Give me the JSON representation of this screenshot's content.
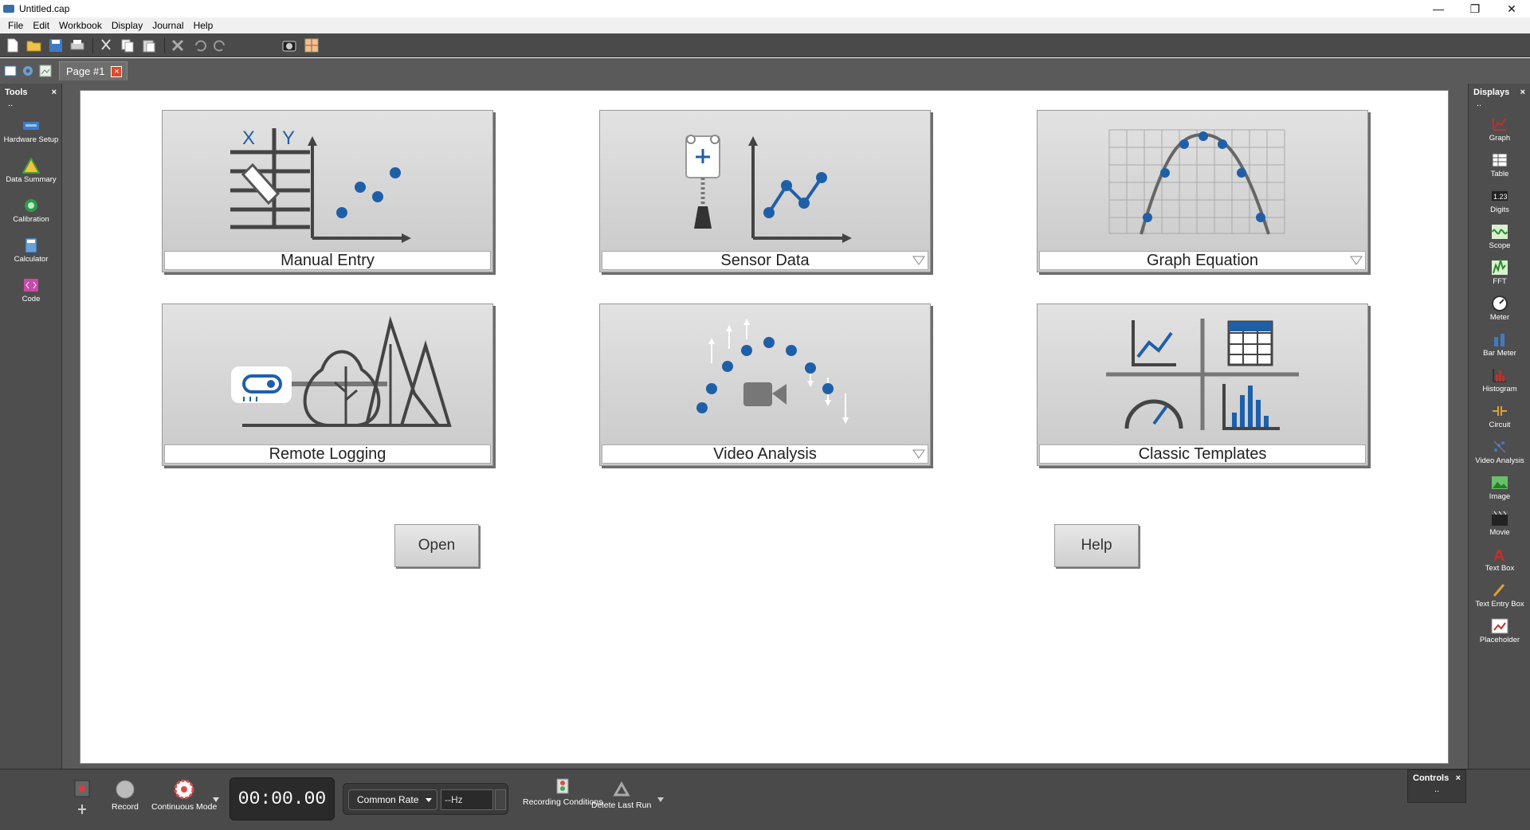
{
  "window": {
    "title": "Untitled.cap",
    "minimize": "—",
    "restore": "❐",
    "close": "✕"
  },
  "menu": [
    "File",
    "Edit",
    "Workbook",
    "Display",
    "Journal",
    "Help"
  ],
  "tabs": {
    "page_label": "Page #1",
    "close_glyph": "×"
  },
  "tools_panel": {
    "title": "Tools",
    "close": "×",
    "dots": "..",
    "items": [
      {
        "label": "Hardware Setup",
        "icon": "hardware-setup-icon"
      },
      {
        "label": "Data Summary",
        "icon": "data-summary-icon"
      },
      {
        "label": "Calibration",
        "icon": "calibration-icon"
      },
      {
        "label": "Calculator",
        "icon": "calculator-icon"
      },
      {
        "label": "Code",
        "icon": "code-icon"
      }
    ]
  },
  "displays_panel": {
    "title": "Displays",
    "close": "×",
    "dots": "..",
    "items": [
      {
        "label": "Graph"
      },
      {
        "label": "Table"
      },
      {
        "label": "Digits"
      },
      {
        "label": "Scope"
      },
      {
        "label": "FFT"
      },
      {
        "label": "Meter"
      },
      {
        "label": "Bar Meter"
      },
      {
        "label": "Histogram"
      },
      {
        "label": "Circuit"
      },
      {
        "label": "Video Analysis"
      },
      {
        "label": "Image"
      },
      {
        "label": "Movie"
      },
      {
        "label": "Text Box"
      },
      {
        "label": "Text Entry Box"
      },
      {
        "label": "Placeholder"
      }
    ]
  },
  "cards": [
    {
      "title": "Manual Entry",
      "has_dropdown": false
    },
    {
      "title": "Sensor Data",
      "has_dropdown": true
    },
    {
      "title": "Graph Equation",
      "has_dropdown": true
    },
    {
      "title": "Remote Logging",
      "has_dropdown": false
    },
    {
      "title": "Video Analysis",
      "has_dropdown": true
    },
    {
      "title": "Classic Templates",
      "has_dropdown": false
    }
  ],
  "buttons": {
    "open": "Open",
    "help": "Help"
  },
  "controls": {
    "record": "Record",
    "continuous_mode": "Continuous Mode",
    "timer": "00:00.00",
    "rate_select": "Common Rate",
    "hz_value": "--Hz",
    "recording_conditions": "Recording Conditions",
    "delete_last_run": "Delete Last Run",
    "panel_title": "Controls",
    "panel_close": "×",
    "panel_dots": ".."
  },
  "colors": {
    "accent_blue": "#1f5fa8",
    "dark_chrome": "#4a4a4a",
    "card_bg": "#d6d6d6"
  }
}
